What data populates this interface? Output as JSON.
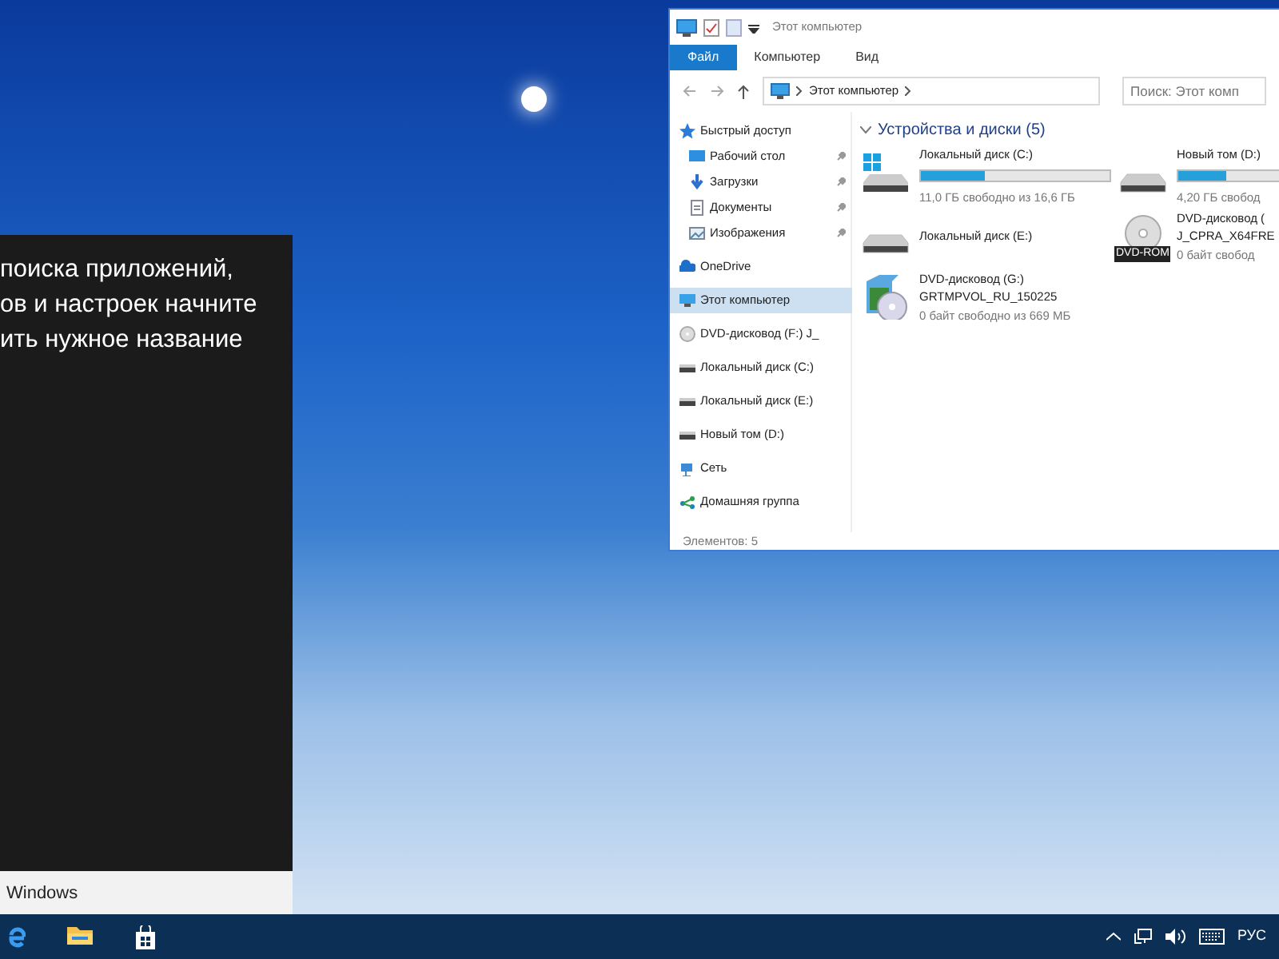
{
  "start_panel": {
    "hint_lines": [
      "поиска приложений,",
      "ов и настроек начните",
      "ить нужное название"
    ],
    "search": {
      "value": "Windows"
    }
  },
  "explorer": {
    "title": "Этот компьютер",
    "ribbon_tabs": [
      {
        "label": "Файл",
        "selected": true
      },
      {
        "label": "Компьютер",
        "selected": false
      },
      {
        "label": "Вид",
        "selected": false
      }
    ],
    "address": "Этот компьютер",
    "search": {
      "placeholder": "Поиск: Этот комп"
    },
    "nav_items": [
      {
        "label": "Быстрый доступ",
        "kind": "star",
        "selected": false,
        "children": [
          {
            "label": "Рабочий стол",
            "kind": "desktop",
            "pinned": true,
            "selected": false
          },
          {
            "label": "Загрузки",
            "kind": "download",
            "pinned": true,
            "selected": false
          },
          {
            "label": "Документы",
            "kind": "document",
            "pinned": true,
            "selected": false
          },
          {
            "label": "Изображения",
            "kind": "picture",
            "pinned": true,
            "selected": false
          }
        ]
      },
      {
        "label": "OneDrive",
        "kind": "cloud",
        "selected": false
      },
      {
        "label": "Этот компьютер",
        "kind": "pc",
        "selected": true
      },
      {
        "label": "DVD-дисковод (F:) J_",
        "kind": "disc",
        "selected": false
      },
      {
        "label": "Локальный диск (C:)",
        "kind": "hdd",
        "selected": false
      },
      {
        "label": "Локальный диск (E:)",
        "kind": "hdd",
        "selected": false
      },
      {
        "label": "Новый том (D:)",
        "kind": "hdd",
        "selected": false
      },
      {
        "label": "Сеть",
        "kind": "network",
        "selected": false
      },
      {
        "label": "Домашняя группа",
        "kind": "homegroup",
        "selected": false
      }
    ],
    "group_title": "Устройства и диски (5)",
    "drives": [
      {
        "kind": "hdd-windows",
        "name": "Локальный диск (C:)",
        "level": 0.34,
        "free": "11,0 ГБ свободно из 16,6 ГБ"
      },
      {
        "kind": "hdd",
        "name": "Новый том (D:)",
        "level": 0.25,
        "free": "4,20 ГБ свобод"
      },
      {
        "kind": "hdd",
        "name": "Локальный диск (E:)"
      },
      {
        "kind": "dvd",
        "name": "DVD-дисковод (",
        "label": "J_CPRA_X64FRE",
        "free": "0 байт свобод",
        "icon_label": "DVD-ROM"
      },
      {
        "kind": "dvd-setup",
        "name": "DVD-дисковод (G:)",
        "label": "GRTMPVOL_RU_150225",
        "free": "0 байт свободно из 669 МБ"
      }
    ],
    "status": "Элементов: 5"
  },
  "taskbar": {
    "language": "РУС"
  }
}
